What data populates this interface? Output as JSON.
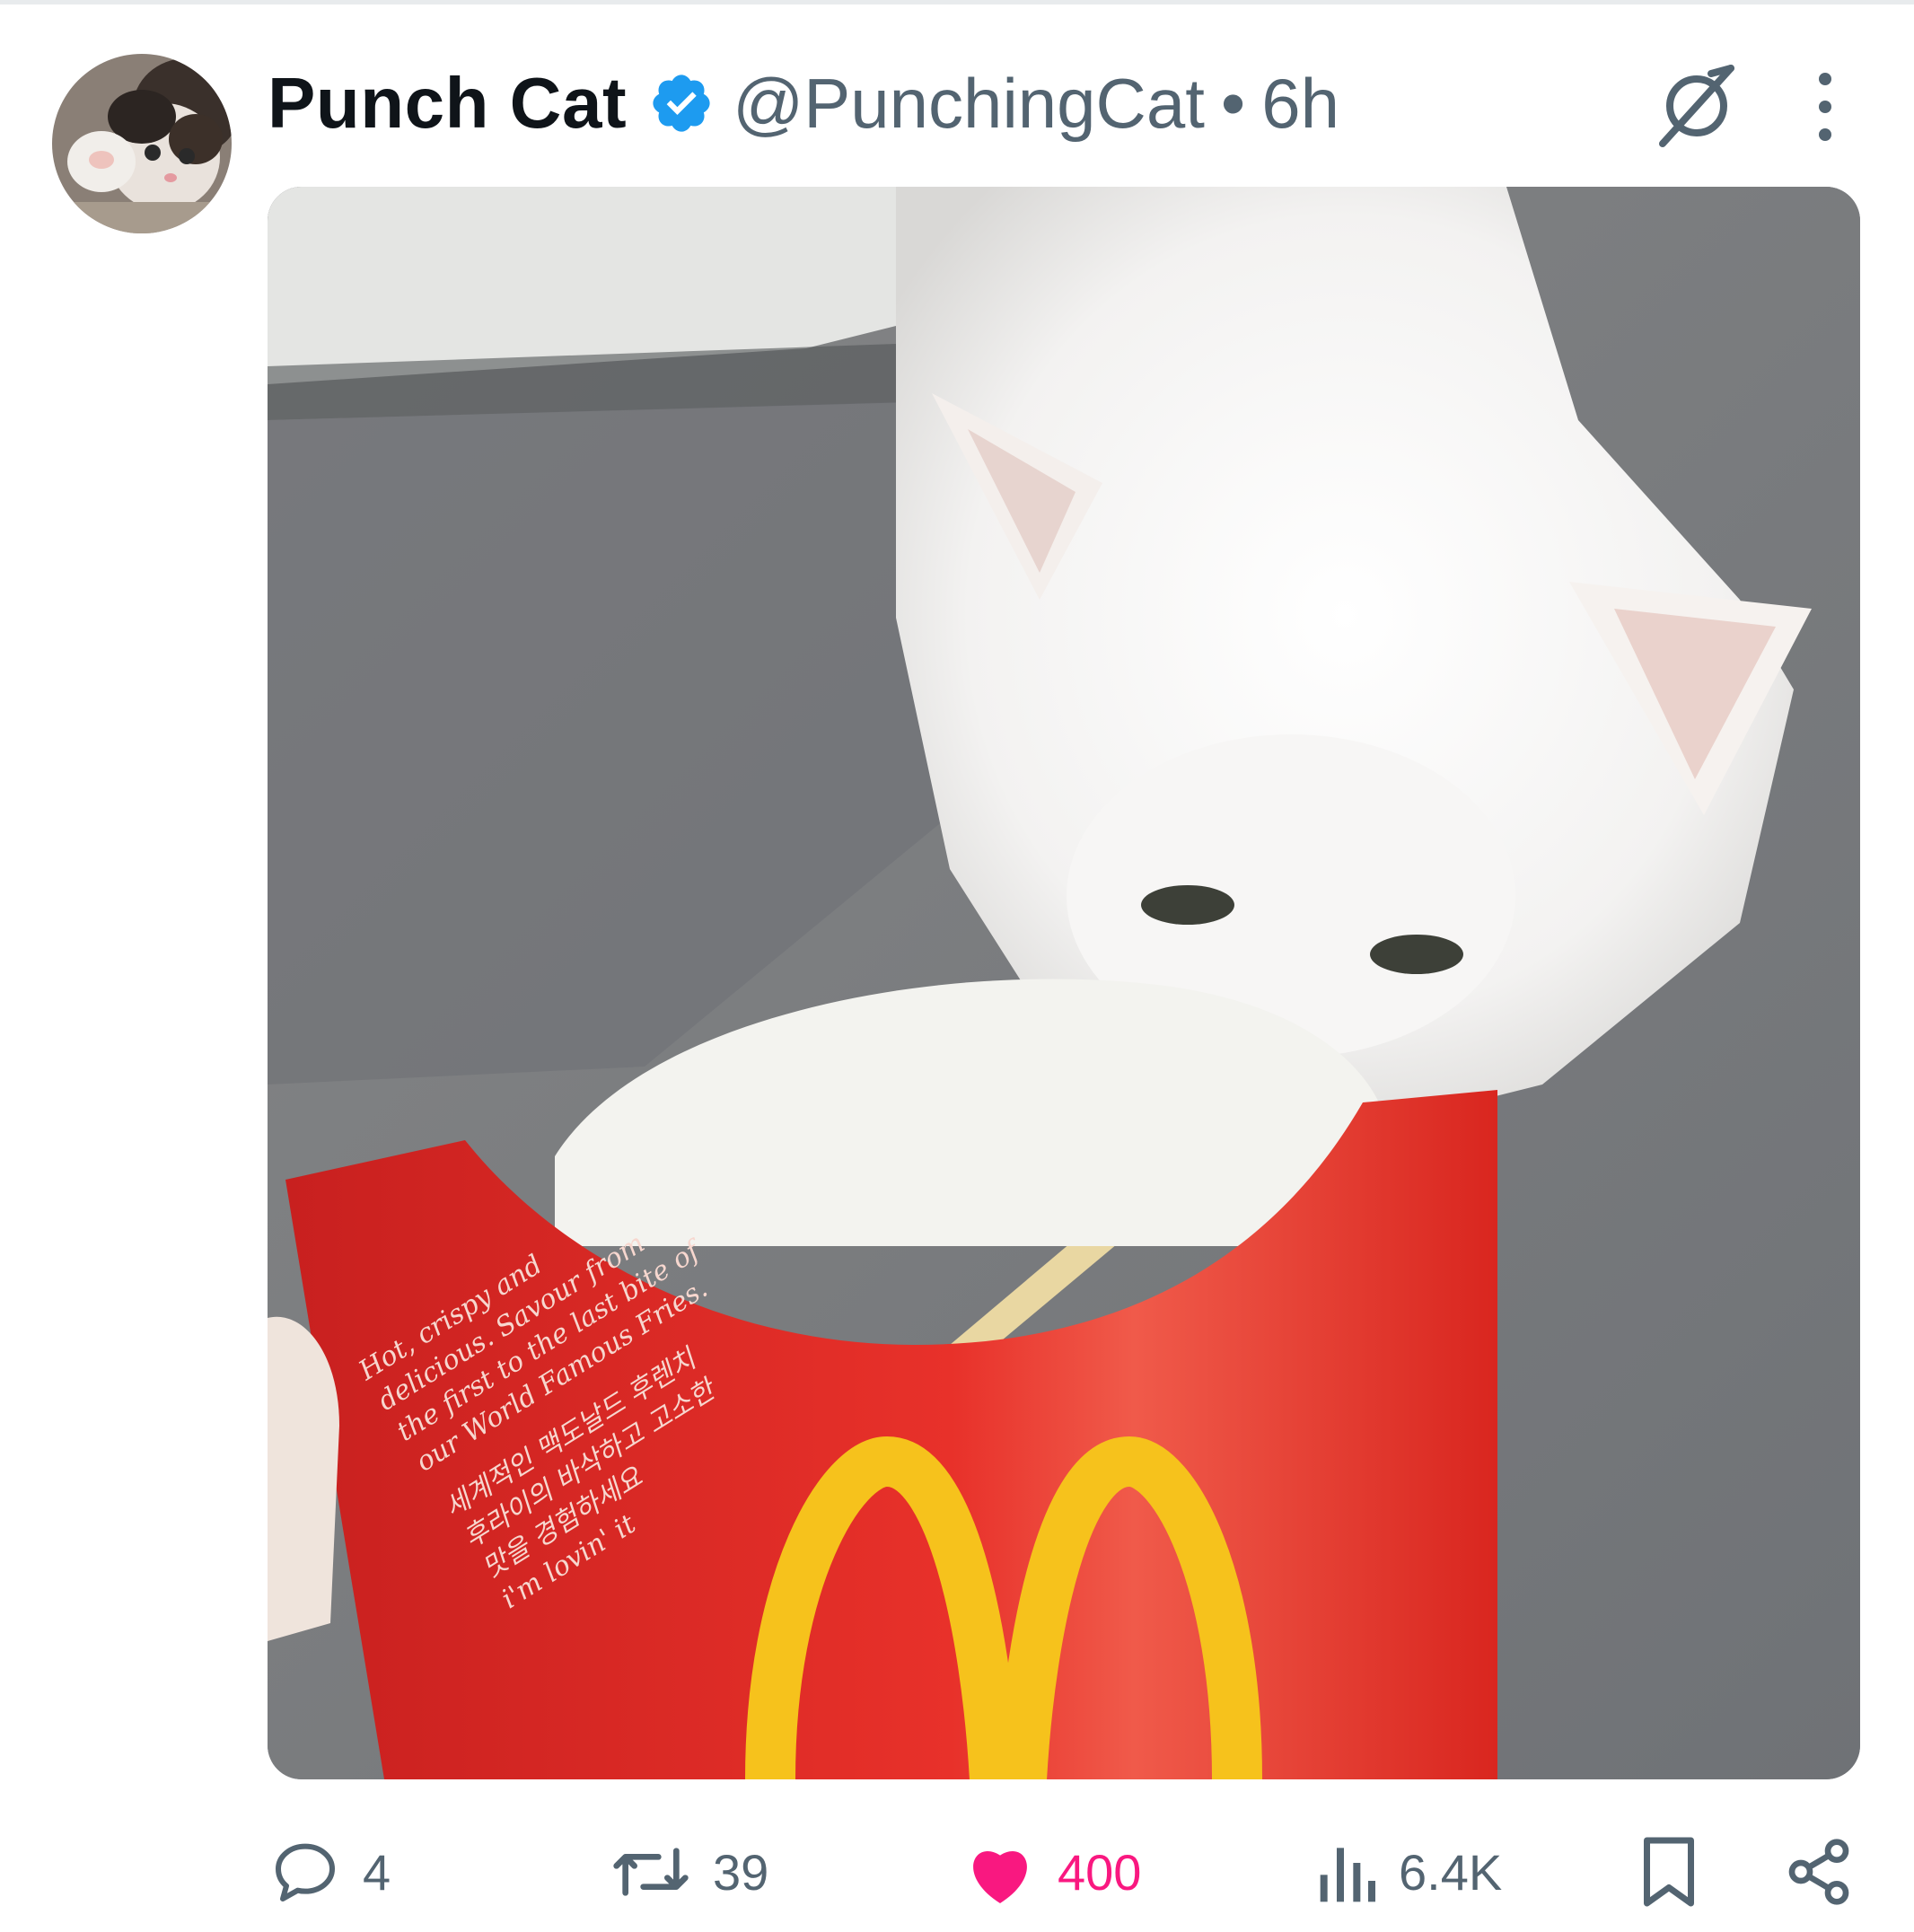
{
  "post": {
    "author_name": "Punch Cat",
    "handle": "@PunchingCat",
    "separator": "•",
    "time": "6h",
    "verified": true
  },
  "media": {
    "box_text": [
      "Hot, crispy and",
      "delicious. Savour from",
      "the first to the last bite of",
      "our World Famous Fries.",
      "세계적인 맥도날드 후렌치",
      "후라이의 바삭하고 고소한",
      "맛을 경험하세요",
      "i'm lovin' it"
    ]
  },
  "actions": {
    "replies": "4",
    "reposts": "39",
    "likes": "400",
    "views": "6.4K"
  },
  "colors": {
    "like_active": "#f91880",
    "verified_blue": "#1d9bf0",
    "muted_text": "#536471",
    "primary_text": "#0f1419"
  },
  "icons": [
    "grok-icon",
    "more-icon",
    "reply-icon",
    "repost-icon",
    "heart-icon",
    "views-icon",
    "bookmark-icon",
    "share-icon"
  ]
}
